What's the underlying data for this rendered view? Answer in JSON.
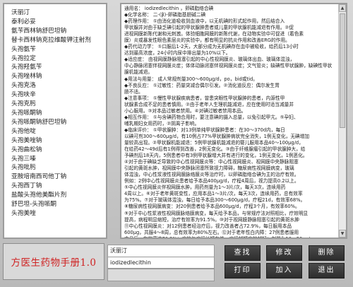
{
  "app_title": "方医生药物手册1.0",
  "drug_list": [
    "沃丽汀",
    "泰利必妥",
    "氨苄西林钠舒巴坦钠",
    "替卡西林钠克拉维酸钾注射剂",
    "头孢氨苄",
    "头孢拉定",
    "头孢羟氨苄",
    "头孢唑林钠",
    "头孢克洛",
    "头孢呋辛",
    "头孢克肟",
    "头孢哌酮钠",
    "头孢哌酮钠舒巴坦钠",
    "头孢他啶",
    "头孢美唑钠",
    "头孢曲松钠",
    "头孢三嗪",
    "头孢吡肟",
    "亚胺培南西司他丁钠",
    "头孢西丁钠",
    "盐酸头孢他美酯片剂",
    "舒巴坦-头孢哌酮",
    "头孢美唑"
  ],
  "detail_lines": [
    "通用名：  iodizedlecithin ，卵磷脂络合碘",
    "  ◆化学名称：  二-(β)-卵磷脂基胆碱二碘",
    "  ◆药理作用：  ①由消化道吸收到血液中，以无机碘的形式起作用，然后结合入",
    "甲状腺并对由于缺乏碘引起的甲状腺肿患者或儿童的甲状腺机能减退有作用。②促",
    "进视网膜新陈代谢和光刺激。体验细胞网膜的新陈代谢，在动物实验中可促进（着色素",
    "膜）炎或暴发性眼色素层炎的实验中，都有明显的抗炎作用和改善ERG的作用。",
    "  ◆药代动力学：  ①口服后1-2天，大部分成为无机碘存在血中被吸收，给药后13小时",
    "达到最高浓度，24小时内尿中排出量为10%以下。",
    "  ◆适应症：  由视网膜静脉阻塞引起的中心性视网膜炎、玻璃体出血、玻璃体混浊，",
    "中心静脉闭塞伴视网膜炎症；体体动脉闭塞伴视网膜炎症；文气管炎；缺碘性甲状腺肿，缺碘性甲状",
    "腺机能减退。",
    "  ◆用法与用量：  成人常规剂量300～600μg/d，po，bid或tid。",
    "  ◆不良反应：  ①过敏性：药量突减合偶尔引发。②消化道反应：偶尔发生胃",
    "肠不适。",
    "  ◆注意事项：  ①慢性甲状腺疾病患者，曾患突眼性甲状腺肿的患者，内源性甲",
    "状腺素合成不足的患者慎用。②由于老年人生理机能减退，应在使用时适当减量并",
    "小心服用。③对本品过敏者禁用。④对碘过敏者禁用本品。",
    "  ◆相互作用：  ①与含碘药物合用时，要注意碘的摄入总量，以免引起甲亢。⑤孕妇、",
    "哺乳期妇女用药时，②阴离子影响。",
    "  ◆临床评价：  ①甲状腺肿：对13例单纯甲状腺肿患者：在30～370d内，每日",
    "以碘可剂300～600μg/d，有10例占77%甲状腺肿病状完全消失，1例无变化，无碘增加",
    "量较高出现。②甲状腺机能减退：5例甲状腺机能减退的婴儿服用本品40～100μg/d，",
    "在给药42～49d后有1例得到改善，2例无变化。③由于纤维腺瘤引起的甲状腺肿大，给",
    "予碘剂后18天内，5例患者中有3例甲状腺增大并有进行的变化，1例无变化，1例恶化。",
    "④对于由于碘缺乏导致的中心性视网膜炎等：中心性视网膜炎、视网膜中央静脉阻塞",
    "引起的黄斑水肿，视网膜中央静脉闭塞所致视力障碍，糖尿病性视网膜病变，玻璃",
    "体混浊，中心性浆液性视网膜脉络膜炎等治疗时，以卵磷脂络合碘为主的治疗有效。",
    "例如：2例中心性视网膜炎患者给予本品400μg/d，疗程4周后，视力提高0.2以上。",
    "⑤中心性视网膜炎伴视网膜水肿，用药剂量为1～3片/次，每天3次，连续用药",
    "4周以上。⑥对于老年黄斑变性，应用本品1～3片/次，每天3次，连续用药，总有效率",
    "为75%。⑦对于玻璃体混浊，每日给予本品300～600μg/d，疗程21d，有效率68%。",
    "⑧糖尿病性视网膜病变：对20例患者给予本品600μg/d，疗程3个月，有效率60%。",
    "⑨对于中心性浆液性视网膜脉络膜病变，每天给予本品，与常规疗法对照相比，疗效明显",
    "提高，病程明显缩短，治疗有效率为91.5%。⑩对于视网膜静脉阻塞引起的黄斑水肿",
    "⑪中心性视网膜炎：对12例患者经治疗后，视力改善者占72.9%，每日服用本品",
    "600μg，共服4～8周，总有效率为80%左右。⑫对于老年性白内障：27例患者服用",
    "本品后，有效率达70.2%；疗效与病程长短有关，病程越短疗效越好；剂量为10～20μg/"
  ],
  "search_name": "沃丽汀",
  "search_english": "iodizedlecithin",
  "buttons": {
    "search": "查找",
    "modify": "修改",
    "delete": "删除",
    "print": "打印",
    "add": "加入",
    "exit": "退出"
  },
  "scroll_arrows": {
    "up": "▲",
    "down": "▼"
  }
}
